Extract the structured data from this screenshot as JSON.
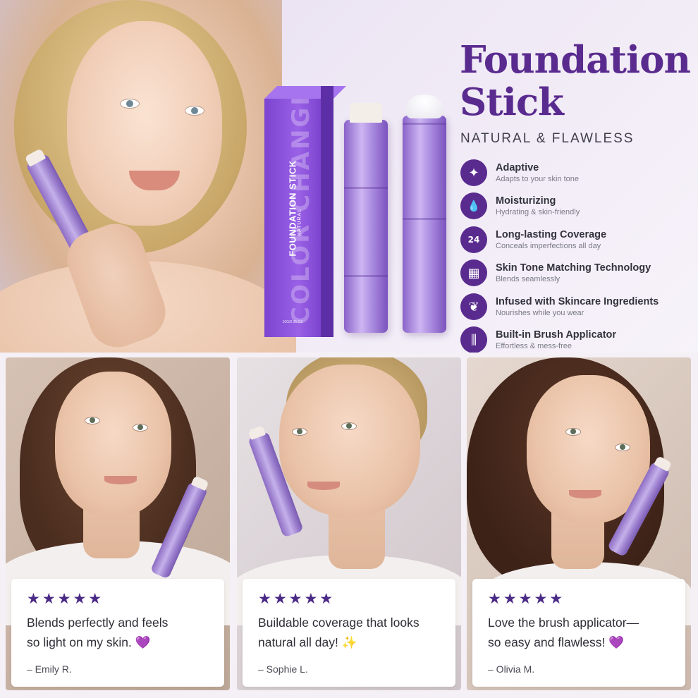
{
  "hero": {
    "title_line1": "Foundation",
    "title_line2": "Stick",
    "subtitle": "NATURAL & FLAWLESS",
    "box": {
      "big_text": "COLOR CHANGING",
      "label": "FOUNDATION STICK",
      "sub_label": "NATURAL",
      "size": "10G/0.35 OZ"
    }
  },
  "features": [
    {
      "icon": "sparkle-icon",
      "glyph": "✦",
      "title": "Adaptive",
      "subtitle": "Adapts to your skin tone"
    },
    {
      "icon": "droplet-icon",
      "glyph": "💧",
      "title": "Moisturizing",
      "subtitle": "Hydrating & skin-friendly"
    },
    {
      "icon": "24-hour-icon",
      "glyph": "24",
      "title": "Long-lasting Coverage",
      "subtitle": "Conceals imperfections all day"
    },
    {
      "icon": "swatches-icon",
      "glyph": "▦",
      "title": "Skin Tone Matching Technology",
      "subtitle": "Blends seamlessly"
    },
    {
      "icon": "leaf-icon",
      "glyph": "❦",
      "title": "Infused with Skincare Ingredients",
      "subtitle": "Nourishes while you wear"
    },
    {
      "icon": "brush-icon",
      "glyph": "⫼",
      "title": "Built-in Brush Applicator",
      "subtitle": "Effortless & mess-free"
    }
  ],
  "reviews": [
    {
      "stars": "★★★★★",
      "line1": "Blends perfectly and feels",
      "line2": "so light on my skin. 💜",
      "author": "– Emily R."
    },
    {
      "stars": "★★★★★",
      "line1": "Buildable coverage that looks",
      "line2": "natural all day! ✨",
      "author": "– Sophie L."
    },
    {
      "stars": "★★★★★",
      "line1": "Love the brush applicator—",
      "line2": "so easy and flawless! 💜",
      "author": "– Olivia M."
    }
  ],
  "colors": {
    "brand_purple": "#5a2b8f",
    "star": "#4b2a86",
    "product": "#9a61e6"
  }
}
